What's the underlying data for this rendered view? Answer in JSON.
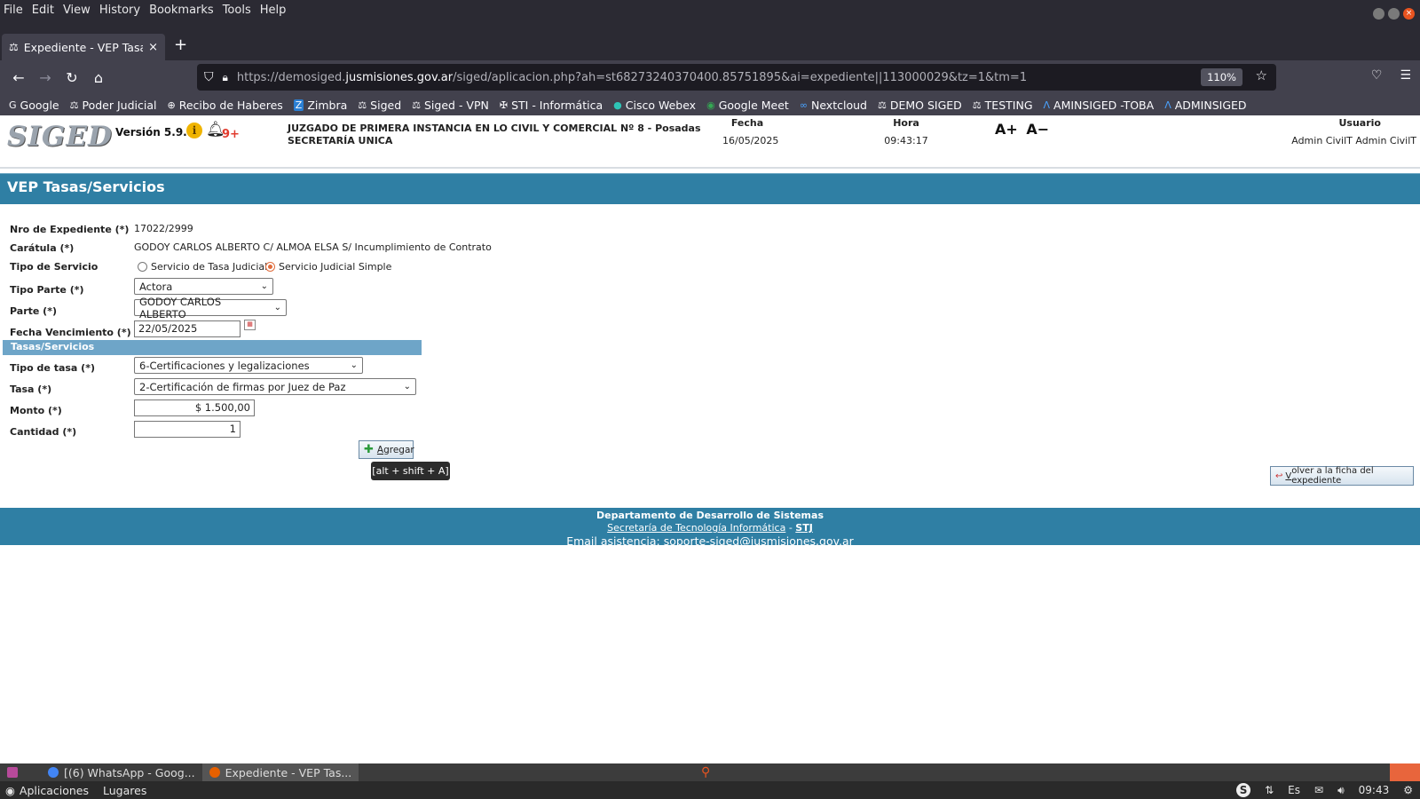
{
  "browser": {
    "menu": [
      "File",
      "Edit",
      "View",
      "History",
      "Bookmarks",
      "Tools",
      "Help"
    ],
    "tab_title": "Expediente - VEP Tasas/S",
    "url_prefix": "https://demosiged.",
    "url_host": "jusmisiones.gov.ar",
    "url_rest": "/siged/aplicacion.php?ah=st68273240370400.85751895&ai=expediente||113000029&tz=1&tm=1",
    "zoom": "110%",
    "bookmarks": [
      {
        "label": "Google",
        "icon": "google-icon"
      },
      {
        "label": "Poder Judicial",
        "icon": "scales-icon"
      },
      {
        "label": "Recibo de Haberes",
        "icon": "globe-icon"
      },
      {
        "label": "Zimbra",
        "icon": "zimbra-icon"
      },
      {
        "label": "Siged",
        "icon": "scales-icon"
      },
      {
        "label": "Siged - VPN",
        "icon": "scales-icon"
      },
      {
        "label": "STI - Informática",
        "icon": "sti-icon"
      },
      {
        "label": "Cisco Webex",
        "icon": "webex-icon"
      },
      {
        "label": "Google Meet",
        "icon": "meet-icon"
      },
      {
        "label": "Nextcloud",
        "icon": "nextcloud-icon"
      },
      {
        "label": "DEMO SIGED",
        "icon": "scales-icon"
      },
      {
        "label": "TESTING",
        "icon": "scales-icon"
      },
      {
        "label": "AMINSIGED -TOBA",
        "icon": "toba-icon"
      },
      {
        "label": "ADMINSIGED",
        "icon": "toba-icon"
      }
    ]
  },
  "header": {
    "logo": "SIGED",
    "version": "Versión 5.9.1",
    "notifications": "9+",
    "court_line1": "JUZGADO DE PRIMERA INSTANCIA EN LO CIVIL Y COMERCIAL Nº 8 - Posadas",
    "court_line2": "SECRETARÍA UNICA",
    "fecha_label": "Fecha",
    "fecha_value": "16/05/2025",
    "hora_label": "Hora",
    "hora_value": "09:43:17",
    "font_increase": "A+",
    "font_decrease": "A−",
    "usuario_label": "Usuario",
    "usuario_value": "Admin CivilT Admin CivilT"
  },
  "page_title": "VEP Tasas/Servicios",
  "form": {
    "expediente_label": "Nro de Expediente (*)",
    "expediente_value": "17022/2999",
    "caratula_label": "Carátula (*)",
    "caratula_value": "GODOY CARLOS ALBERTO C/ ALMOA ELSA S/ Incumplimiento de Contrato",
    "tipo_servicio_label": "Tipo de Servicio",
    "tipo_servicio_opt1": "Servicio de Tasa Judicial",
    "tipo_servicio_opt2": "Servicio Judicial Simple",
    "tipo_servicio_selected": "Servicio Judicial Simple",
    "tipo_parte_label": "Tipo Parte (*)",
    "tipo_parte_value": "Actora",
    "parte_label": "Parte (*)",
    "parte_value": "GODOY CARLOS ALBERTO",
    "fecha_venc_label": "Fecha Vencimiento (*)",
    "fecha_venc_value": "22/05/2025",
    "section_title": "Tasas/Servicios",
    "tipo_tasa_label": "Tipo de tasa (*)",
    "tipo_tasa_value": "6-Certificaciones y legalizaciones",
    "tasa_label": "Tasa (*)",
    "tasa_value": "2-Certificación de firmas por Juez de Paz",
    "monto_label": "Monto (*)",
    "monto_value": "$ 1.500,00",
    "cantidad_label": "Cantidad (*)",
    "cantidad_value": "1",
    "agregar_first": "A",
    "agregar_rest": "gregar",
    "agregar_tooltip": "[alt + shift + A]",
    "volver_first": "V",
    "volver_rest": "olver a la ficha del expediente"
  },
  "footer": {
    "line1": "Departamento de Desarrollo de Sistemas",
    "link1": "Secretaría de Tecnología Informática",
    "separator": "-",
    "link2": "STJ",
    "email": "Email asistencia: soporte-siged@jusmisiones.gov.ar"
  },
  "desktop": {
    "task1": "[(6) WhatsApp - Goog...",
    "task2": "Expediente - VEP Tas...",
    "aplicaciones": "Aplicaciones",
    "lugares": "Lugares",
    "clock": "09:43",
    "lang": "Es"
  },
  "colors": {
    "accent": "#2f7fa4",
    "section": "#6ea5c8",
    "radio_selected": "#e06c3c"
  }
}
